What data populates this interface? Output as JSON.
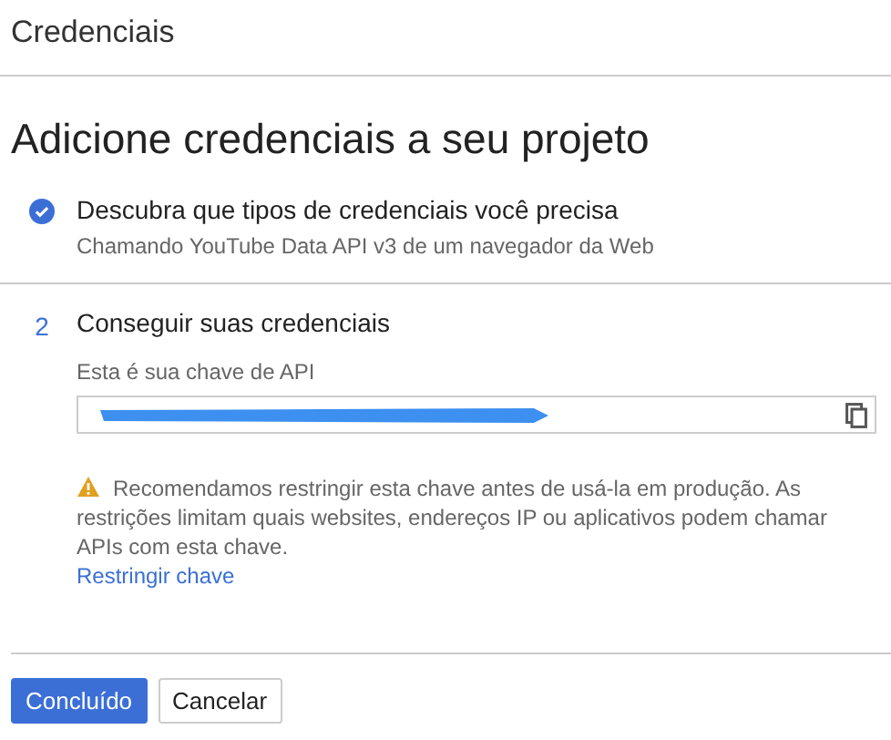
{
  "header": {
    "title": "Credenciais"
  },
  "page_title": "Adicione credenciais a seu projeto",
  "steps": [
    {
      "done": true,
      "title": "Descubra que tipos de credenciais você precisa",
      "subtitle": "Chamando YouTube Data API v3 de um navegador da Web"
    },
    {
      "done": false,
      "number": "2",
      "title": "Conseguir suas credenciais",
      "field_label": "Esta é sua chave de API",
      "warning": "Recomendamos restringir esta chave antes de usá-la em produção. As restrições limitam quais websites, endereços IP ou aplicativos podem chamar APIs com esta chave.",
      "link": "Restringir chave"
    }
  ],
  "buttons": [
    {
      "label": "Concluído",
      "kind": "primary"
    },
    {
      "label": "Cancelar",
      "kind": "secondary"
    }
  ]
}
